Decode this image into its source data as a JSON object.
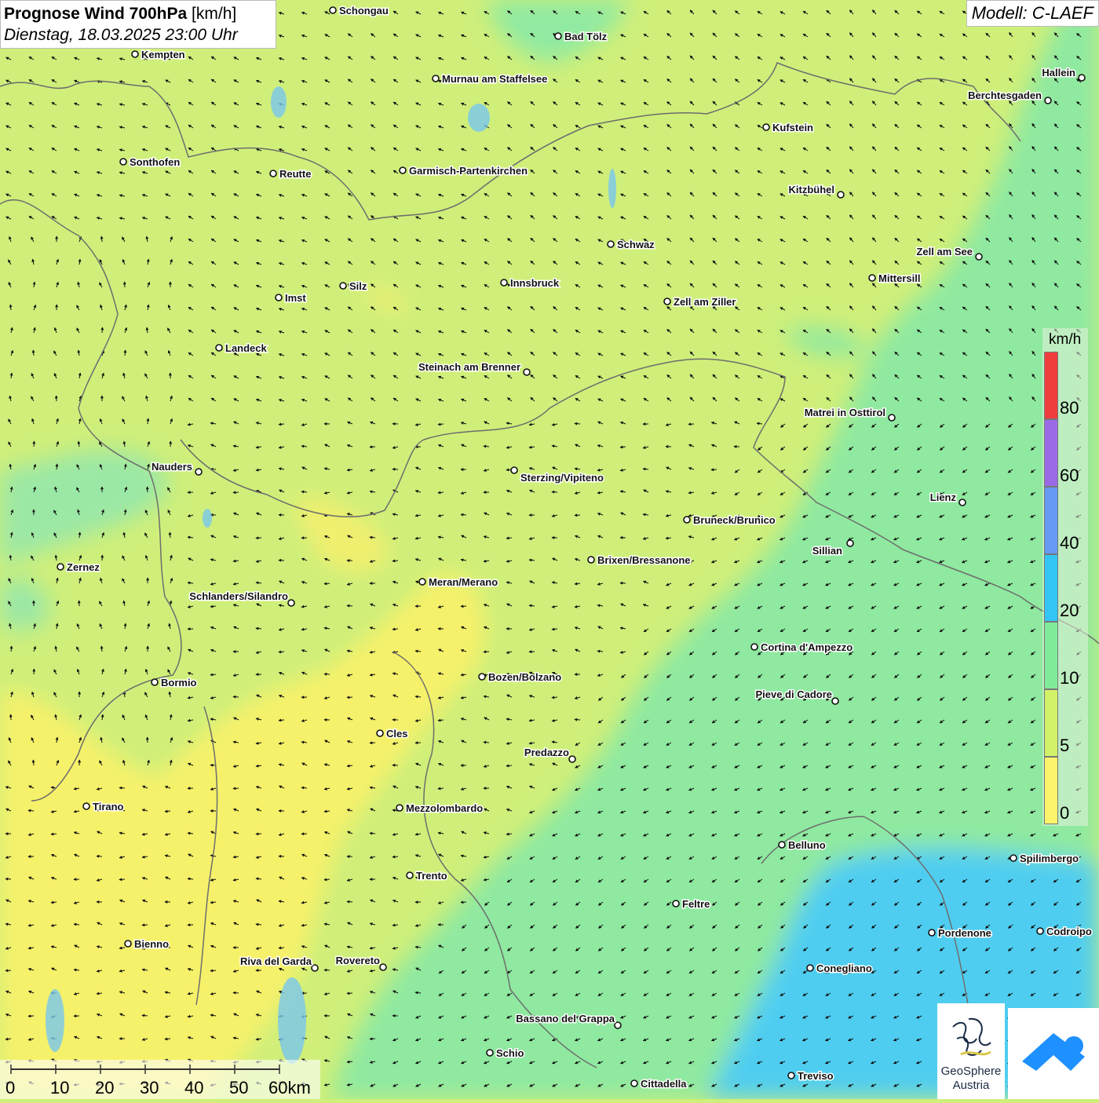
{
  "title": {
    "bold": "Prognose Wind 700hPa",
    "unit": "[km/h]",
    "datetime": "Dienstag, 18.03.2025 23:00 Uhr"
  },
  "model": "Modell: C-LAEF",
  "legend": {
    "unit": "km/h",
    "labels": [
      "80",
      "60",
      "40",
      "20",
      "10",
      "5",
      "0"
    ],
    "colors": {
      "band_80_plus": "#f03c3c",
      "band_60_80": "#9b6be6",
      "band_40_60": "#6699f2",
      "band_20_40": "#33c6f5",
      "band_10_20": "#80ec9a",
      "band_5_10": "#d2f26a",
      "band_0_5": "#fbf46c"
    }
  },
  "scale": {
    "labels": [
      "0",
      "10",
      "20",
      "30",
      "40",
      "50",
      "60km"
    ]
  },
  "logo": {
    "line1": "GeoSphere",
    "line2": "Austria"
  },
  "cities": [
    {
      "name": "Schongau"
    },
    {
      "name": "Bad Tölz"
    },
    {
      "name": "Kempten"
    },
    {
      "name": "Murnau am Staffelsee"
    },
    {
      "name": "Hallein"
    },
    {
      "name": "Berchtesgaden"
    },
    {
      "name": "Kufstein"
    },
    {
      "name": "Sonthofen"
    },
    {
      "name": "Reutte"
    },
    {
      "name": "Garmisch-Partenkirchen"
    },
    {
      "name": "Kitzbühel"
    },
    {
      "name": "Schwaz"
    },
    {
      "name": "Zell am See"
    },
    {
      "name": "Mittersill"
    },
    {
      "name": "Innsbruck"
    },
    {
      "name": "Silz"
    },
    {
      "name": "Imst"
    },
    {
      "name": "Zell am Ziller"
    },
    {
      "name": "Landeck"
    },
    {
      "name": "Steinach am Brenner"
    },
    {
      "name": "Matrei in Osttirol"
    },
    {
      "name": "Nauders"
    },
    {
      "name": "Sterzing/Vipiteno"
    },
    {
      "name": "Lienz"
    },
    {
      "name": "Bruneck/Brunico"
    },
    {
      "name": "Sillian"
    },
    {
      "name": "Zernez"
    },
    {
      "name": "Brixen/Bressanone"
    },
    {
      "name": "Meran/Merano"
    },
    {
      "name": "Schlanders/Silandro"
    },
    {
      "name": "Cortina d'Ampezzo"
    },
    {
      "name": "Bormio"
    },
    {
      "name": "Bozen/Bolzano"
    },
    {
      "name": "Pieve di Cadore"
    },
    {
      "name": "Cles"
    },
    {
      "name": "Predazzo"
    },
    {
      "name": "Tirano"
    },
    {
      "name": "Mezzolombardo"
    },
    {
      "name": "Belluno"
    },
    {
      "name": "Spilimbergo"
    },
    {
      "name": "Trento"
    },
    {
      "name": "Feltre"
    },
    {
      "name": "Pordenone"
    },
    {
      "name": "Codroipo"
    },
    {
      "name": "Bienno"
    },
    {
      "name": "Riva del Garda"
    },
    {
      "name": "Rovereto"
    },
    {
      "name": "Conegliano"
    },
    {
      "name": "Bassano del Grappa"
    },
    {
      "name": "Schio"
    },
    {
      "name": "Treviso"
    },
    {
      "name": "Cittadella"
    }
  ]
}
